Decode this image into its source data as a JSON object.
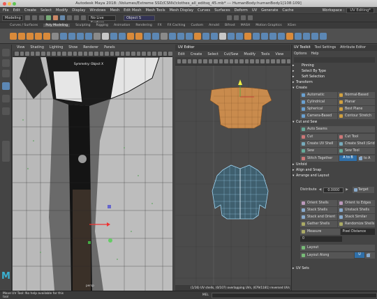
{
  "window": {
    "title": "Autodesk Maya 2018: /Volumes/Extreme SSD/CSNV/clothes_all_editsq_45.mb*  ---  HumanBody:humanBody1[108:109]"
  },
  "menubar": [
    "File",
    "Edit",
    "Create",
    "Select",
    "Modify",
    "Display",
    "Windows",
    "Mesh",
    "Edit Mesh",
    "Mesh Tools",
    "Mesh Display",
    "Curves",
    "Surfaces",
    "Deform",
    "UV",
    "Generate",
    "Cache"
  ],
  "workspace": {
    "label": "Workspace :",
    "value": "UV Editing*"
  },
  "statusline": {
    "mode": "Modeling",
    "live": "No Live Surface",
    "object": "Object S"
  },
  "shelf_tabs": [
    "Curves / Surfaces",
    "Poly Modeling",
    "Sculpting",
    "Rigging",
    "Animation",
    "Rendering",
    "FX",
    "FX Caching",
    "Custom",
    "Arnold",
    "Bifrost",
    "MASH",
    "Motion Graphics",
    "XGen"
  ],
  "shelf_active": "Poly Modeling",
  "panel_menu": [
    "View",
    "Shading",
    "Lighting",
    "Show",
    "Renderer",
    "Panels"
  ],
  "viewport": {
    "hud_label": "Symmetry: Object X",
    "camera": "persp"
  },
  "uv_editor": {
    "title": "UV Editor",
    "menu": [
      "Edit",
      "Create",
      "Select",
      "Cut/Sew",
      "Modify",
      "Tools",
      "View"
    ],
    "footer": "(1/16) UV shells, (0/107) overlapping UVs, (679/1181) reversed UVs"
  },
  "toolkit": {
    "tabs": [
      "UV Toolkit",
      "Tool Settings",
      "Attribute Editor"
    ],
    "menu": [
      "Options",
      "Help"
    ],
    "rows_top": [
      "Pinning",
      "Select By Type",
      "Soft Selection"
    ],
    "transform": "Transform",
    "create": "Create",
    "create_buttons": [
      "Automatic",
      "Normal-Based",
      "Cylindrical",
      "Planar",
      "Spherical",
      "Best Plane",
      "Camera-Based",
      "Contour Stretch"
    ],
    "cut_and_sew": "Cut and Sew",
    "auto_seams": "Auto Seams",
    "cut_buttons": [
      "Cut",
      "Cut Tool",
      "Create UV Shell",
      "Create Shell (Grid)",
      "Sew",
      "Sew Tool"
    ],
    "stitch_together": "Stitch Together",
    "a_to_b": "A to B",
    "b_to_a": "B to A",
    "unfold": "Unfold",
    "align_snap": "Align and Snap",
    "arrange": "Arrange and Layout",
    "distribute": "Distribute",
    "distribute_value": "0.0000",
    "target": "Target",
    "arrange_buttons": [
      "Orient Shells",
      "Orient to Edges",
      "Stack Shells",
      "Unstack Shells",
      "Stack and Orient",
      "Stack Similar",
      "Gather Shells",
      "Randomize Shells"
    ],
    "measure": "Measure",
    "measure_mode": "Pixel Distance",
    "measure_value": "0",
    "layout": "Layout",
    "layout_along": "Layout Along",
    "u": "U",
    "v": "V",
    "uv_sets": "UV Sets"
  },
  "bottom": {
    "help": "Move UV Tool: No help available for this tool",
    "mel": "MEL"
  },
  "colors": {
    "accent": "#2f6fa8",
    "uv_orange": "#c98b4d",
    "uv_blue": "#9fd6f4"
  }
}
